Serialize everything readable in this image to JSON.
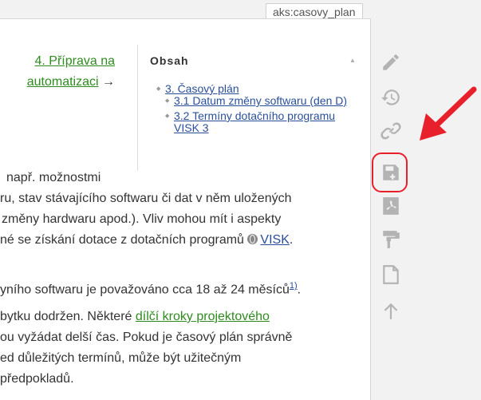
{
  "page_id": "aks:casovy_plan",
  "nav": {
    "link_text": "4. Příprava na automatizaci",
    "arrow": "→"
  },
  "toc": {
    "title": "Obsah",
    "collapse_glyph": "▲",
    "items": [
      {
        "label": "3. Časový plán",
        "children": [
          {
            "label": "3.1 Datum změny softwaru (den D)"
          },
          {
            "label": "3.2 Termíny dotačního programu VISK 3"
          }
        ]
      }
    ]
  },
  "body": {
    "p1_l1": "např. možnostmi",
    "p1_l2": "ru, stav stávajícího softwaru či dat v něm uložených",
    "p1_l3": "změny hardwaru apod.). Vliv mohou mít i aspekty",
    "p1_l4a": "né se získání dotace z dotačních programů ",
    "p1_link": "VISK",
    "p1_l4b": ".",
    "p2a": "yního softwaru je považováno cca 18 až 24 měsíců",
    "p2_footnote": "1)",
    "p2b": ".",
    "p3_l1a": "bytku dodržen. Některé ",
    "p3_link": "dílčí kroky projektového",
    "p3_l2": "ou vyžádat delší čas. Pokud je časový plán správně",
    "p3_l3": "ed důležitých termínů, může být užitečným",
    "p3_l4": " předpokladů."
  },
  "colors": {
    "link_green": "#2e8c1f",
    "link_blue": "#2a4f9a",
    "icon_gray": "#b3b3b3",
    "highlight_red": "#e8202b"
  },
  "tools": [
    {
      "name": "edit-icon"
    },
    {
      "name": "revisions-icon"
    },
    {
      "name": "backlinks-icon"
    },
    {
      "name": "save-icon"
    },
    {
      "name": "pdf-icon"
    },
    {
      "name": "paint-roller-icon"
    },
    {
      "name": "document-icon"
    },
    {
      "name": "arrow-up-icon"
    }
  ]
}
